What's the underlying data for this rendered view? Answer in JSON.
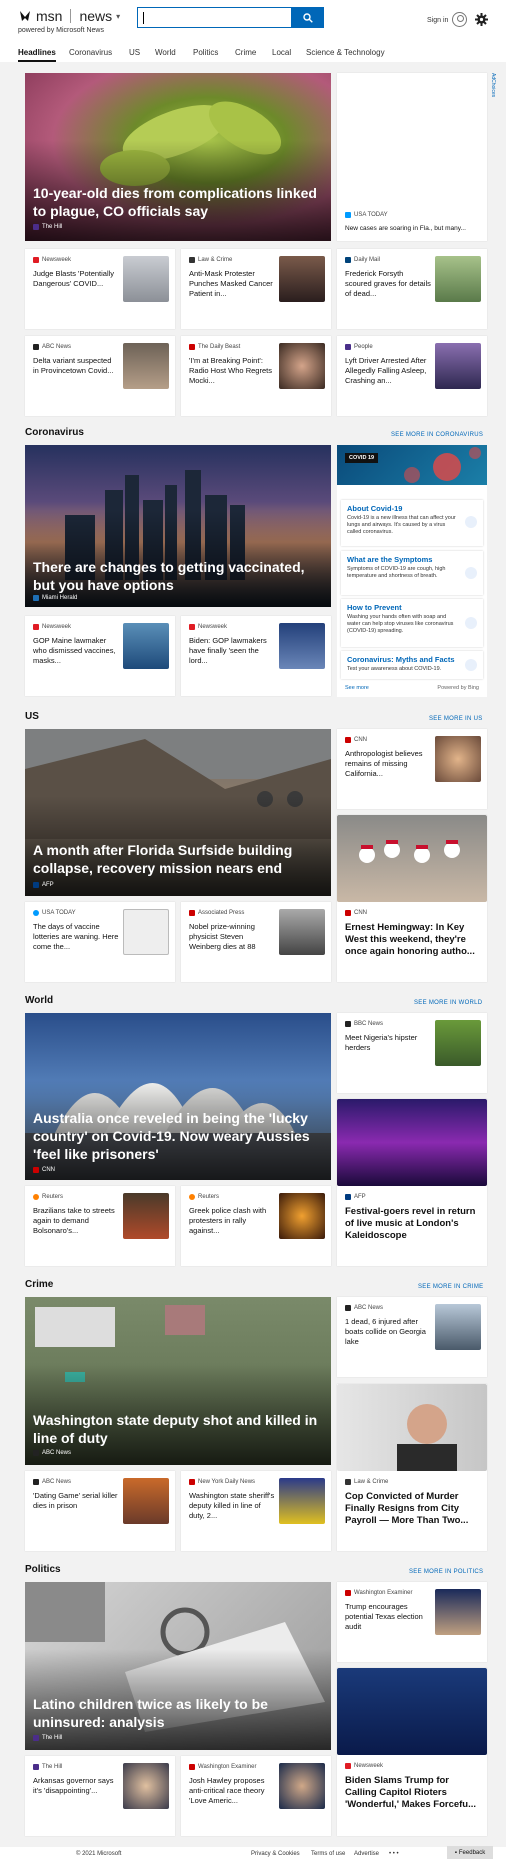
{
  "header": {
    "brand": "msn",
    "product": "news",
    "powered": "powered by Microsoft News",
    "signin": "Sign in"
  },
  "tabs": [
    "Headlines",
    "Coronavirus",
    "US",
    "World",
    "Politics",
    "Crime",
    "Local",
    "Science & Technology"
  ],
  "ad_label": "AdChoices",
  "headlines": {
    "hero": {
      "title": "10-year-old dies from complications linked to plague, CO officials say",
      "source": "The Hill"
    },
    "side_top": {
      "source": "USA TODAY",
      "title": "New cases are soaring in Fla., but many..."
    },
    "cards": [
      {
        "source": "Newsweek",
        "title": "Judge Blasts 'Potentially Dangerous' COVID..."
      },
      {
        "source": "Law & Crime",
        "title": "Anti-Mask Protester Punches Masked Cancer Patient in..."
      },
      {
        "source": "Daily Mail",
        "title": "Frederick Forsyth scoured graves for details of dead..."
      },
      {
        "source": "ABC News",
        "title": "Delta variant suspected in Provincetown Covid..."
      },
      {
        "source": "The Daily Beast",
        "title": "'I'm at Breaking Point': Radio Host Who Regrets Mocki..."
      },
      {
        "source": "People",
        "title": "Lyft Driver Arrested After Allegedly Falling Asleep, Crashing an..."
      }
    ]
  },
  "coronavirus": {
    "title": "Coronavirus",
    "see_more": "SEE MORE IN CORONAVIRUS",
    "hero": {
      "title": "There are changes to getting vaccinated, but you have options",
      "source": "Miami Herald"
    },
    "cards": [
      {
        "source": "Newsweek",
        "title": "GOP Maine lawmaker who dismissed vaccines, masks..."
      },
      {
        "source": "Newsweek",
        "title": "Biden: GOP lawmakers have finally 'seen the lord..."
      }
    ],
    "info": {
      "badge": "COVID 19",
      "items": [
        {
          "title": "About Covid-19",
          "desc": "Covid-19 is a new illness that can affect your lungs and airways. It's caused by a virus called coronavirus."
        },
        {
          "title": "What are the Symptoms",
          "desc": "Symptoms of COVID-19 are cough, high temperature and shortness of breath."
        },
        {
          "title": "How to Prevent",
          "desc": "Washing your hands often with soap and water can help stop viruses like coronavirus (COVID-19) spreading."
        },
        {
          "title": "Coronavirus: Myths and Facts",
          "desc": "Test your awareness about COVID-19."
        }
      ],
      "see_more": "See more",
      "powered": "Powered by Bing"
    }
  },
  "us": {
    "title": "US",
    "see_more": "SEE MORE IN US",
    "hero": {
      "title": "A month after Florida Surfside building collapse, recovery mission nears end",
      "source": "AFP"
    },
    "side": {
      "source": "CNN",
      "title": "Anthropologist believes remains of missing California..."
    },
    "side_big": {
      "source": "CNN",
      "title": "Ernest Hemingway: In Key West this weekend, they're once again honoring autho..."
    },
    "cards": [
      {
        "source": "USA TODAY",
        "title": "The days of vaccine lotteries are waning. Here come the..."
      },
      {
        "source": "Associated Press",
        "title": "Nobel prize-winning physicist Steven Weinberg dies at 88"
      }
    ]
  },
  "world": {
    "title": "World",
    "see_more": "SEE MORE IN WORLD",
    "hero": {
      "title": "Australia once reveled in being the 'lucky country' on Covid-19. Now weary Aussies 'feel like prisoners'",
      "source": "CNN"
    },
    "side": {
      "source": "BBC News",
      "title": "Meet Nigeria's hipster herders"
    },
    "side_big": {
      "source": "AFP",
      "title": "Festival-goers revel in return of live music at London's Kaleidoscope"
    },
    "cards": [
      {
        "source": "Reuters",
        "title": "Brazilians take to streets again to demand Bolsonaro's..."
      },
      {
        "source": "Reuters",
        "title": "Greek police clash with protesters in rally against..."
      }
    ]
  },
  "crime": {
    "title": "Crime",
    "see_more": "SEE MORE IN CRIME",
    "hero": {
      "title": "Washington state deputy shot and killed in line of duty",
      "source": "ABC News"
    },
    "side": {
      "source": "ABC News",
      "title": "1 dead, 6 injured after boats collide on Georgia lake"
    },
    "side_big": {
      "source": "Law & Crime",
      "title": "Cop Convicted of Murder Finally Resigns from City Payroll — More Than Two..."
    },
    "cards": [
      {
        "source": "ABC News",
        "title": "'Dating Game' serial killer dies in prison"
      },
      {
        "source": "New York Daily News",
        "title": "Washington state sheriff's deputy killed in line of duty, 2..."
      }
    ]
  },
  "politics": {
    "title": "Politics",
    "see_more": "SEE MORE IN POLITICS",
    "hero": {
      "title": "Latino children twice as likely to be uninsured: analysis",
      "source": "The Hill"
    },
    "side": {
      "source": "Washington Examiner",
      "title": "Trump encourages potential Texas election audit"
    },
    "side_big": {
      "source": "Newsweek",
      "title": "Biden Slams Trump for Calling Capitol Rioters 'Wonderful,' Makes Forcefu..."
    },
    "cards": [
      {
        "source": "The Hill",
        "title": "Arkansas governor says it's 'disappointing'..."
      },
      {
        "source": "Washington Examiner",
        "title": "Josh Hawley proposes anti-critical race theory 'Love Americ..."
      }
    ]
  },
  "footer": {
    "copyright": "© 2021 Microsoft",
    "privacy": "Privacy & Cookies",
    "terms": "Terms of use",
    "advertise": "Advertise",
    "more": "• • •",
    "feedback": "Feedback"
  }
}
